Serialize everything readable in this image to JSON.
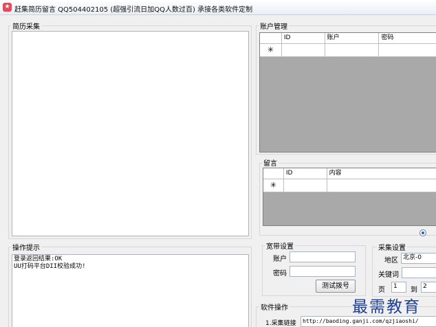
{
  "window": {
    "title": "赶集简历留言 QQ504402105 (超强引流日加QQ人数过百) 承接各类软件定制",
    "icon_char": "★"
  },
  "resume_collect": {
    "label": "简历采集"
  },
  "operation_tips": {
    "label": "操作提示",
    "log": "登录返回结果:OK\nUU打码平台DII校验成功!"
  },
  "account_mgmt": {
    "label": "账户管理",
    "columns": [
      "ID",
      "账户",
      "密码"
    ],
    "new_row_marker": "✳"
  },
  "message": {
    "label": "留言",
    "columns": [
      "ID",
      "内容"
    ],
    "new_row_marker": "✳"
  },
  "broadband": {
    "label": "宽带设置",
    "account_label": "账户",
    "account_value": "",
    "password_label": "密码",
    "password_value": "",
    "test_dial_button": "测试拨号"
  },
  "collect_settings": {
    "label": "采集设置",
    "region_label": "地区",
    "region_value": "北京-0",
    "keyword_label": "关键词",
    "keyword_value": "",
    "page_label": "页",
    "page_from": "1",
    "to_label": "到",
    "page_to": "2"
  },
  "software_ops": {
    "label": "软件操作",
    "link_label": "1.采集链接",
    "link_value": "http://baoding.ganji.com/qzjiaoshi/"
  },
  "watermark": "最需教育"
}
